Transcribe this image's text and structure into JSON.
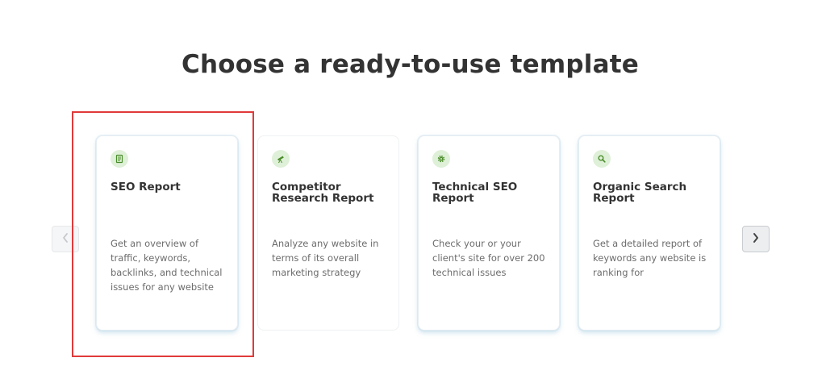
{
  "heading": "Choose a ready-to-use template",
  "colors": {
    "icon_bg": "#dff0d8",
    "icon_fg": "#4a8c2a",
    "highlight": "#e03a3a"
  },
  "cards": [
    {
      "title": "SEO Report",
      "description": "Get an overview of traffic, keywords, backlinks, and technical issues for any website",
      "icon": "report-icon"
    },
    {
      "title": "Competitor Research Report",
      "description": "Analyze any website in terms of its overall marketing strategy",
      "icon": "telescope-icon"
    },
    {
      "title": "Technical SEO Report",
      "description": "Check your or your client's site for over 200 technical issues",
      "icon": "gear-icon"
    },
    {
      "title": "Organic Search Report",
      "description": "Get a detailed report of keywords any website is ranking for",
      "icon": "search-icon"
    }
  ],
  "carousel": {
    "prev_icon": "chevron-left-icon",
    "next_icon": "chevron-right-icon"
  }
}
